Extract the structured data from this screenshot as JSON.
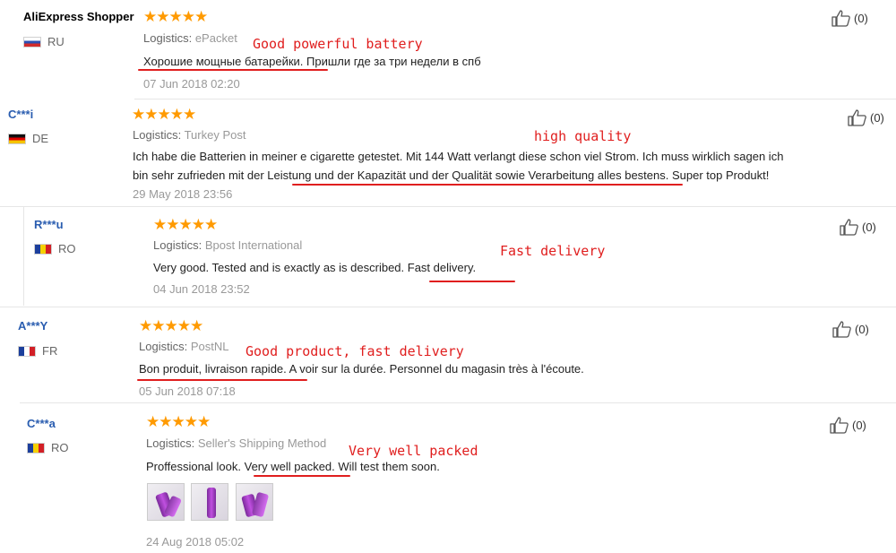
{
  "reviews": [
    {
      "user": "AliExpress Shopper",
      "country": "RU",
      "stars": "★★★★★",
      "logistics_label": "Logistics:",
      "logistics": "ePacket",
      "text_pre": "",
      "text_hl": "Хорошие мощные батарейки.",
      "text_post": " Пришли где за три недели в спб",
      "date": "07 Jun 2018 02:20",
      "helpful_count": "(0)",
      "annotation": "Good powerful battery"
    },
    {
      "user": "C***i",
      "country": "DE",
      "stars": "★★★★★",
      "logistics_label": "Logistics:",
      "logistics": "Turkey Post",
      "text_line1": "Ich habe die Batterien in meiner e cigarette getestet. Mit 144 Watt verlangt diese schon viel Strom. Ich muss wirklich sagen ich",
      "text_line2_pre": "bin sehr zufrieden mit der ",
      "text_line2_hl": "Leistung und der Kapazität und der Qualität sowie Verarbeitung",
      "text_line2_post": " alles bestens. Super top Produkt!",
      "date": "29 May 2018 23:56",
      "helpful_count": "(0)",
      "annotation": "high quality"
    },
    {
      "user": "R***u",
      "country": "RO",
      "stars": "★★★★★",
      "logistics_label": "Logistics:",
      "logistics": "Bpost International",
      "text_pre": "Very good. Tested and is exactly as is described. ",
      "text_hl": "Fast delivery.",
      "text_post": "",
      "date": "04 Jun 2018 23:52",
      "helpful_count": "(0)",
      "annotation": "Fast delivery"
    },
    {
      "user": "A***Y",
      "country": "FR",
      "stars": "★★★★★",
      "logistics_label": "Logistics:",
      "logistics": "PostNL",
      "text_pre": "",
      "text_hl": "Bon produit, livraison rapide.",
      "text_post": " A voir sur la durée. Personnel du magasin très à l'écoute.",
      "date": "05 Jun 2018 07:18",
      "helpful_count": "(0)",
      "annotation": "Good product, fast delivery"
    },
    {
      "user": "C***a",
      "country": "RO",
      "stars": "★★★★★",
      "logistics_label": "Logistics:",
      "logistics": "Seller's Shipping Method",
      "text_pre": "Proffessional look. ",
      "text_hl": "Very well packed.",
      "text_post": " Will test them soon.",
      "date": "24 Aug 2018 05:02",
      "helpful_count": "(0)",
      "annotation": "Very well packed"
    }
  ],
  "colors": {
    "star": "#ff9a00",
    "annotation": "#e01e1e",
    "masked_name": "#2a5db0"
  }
}
